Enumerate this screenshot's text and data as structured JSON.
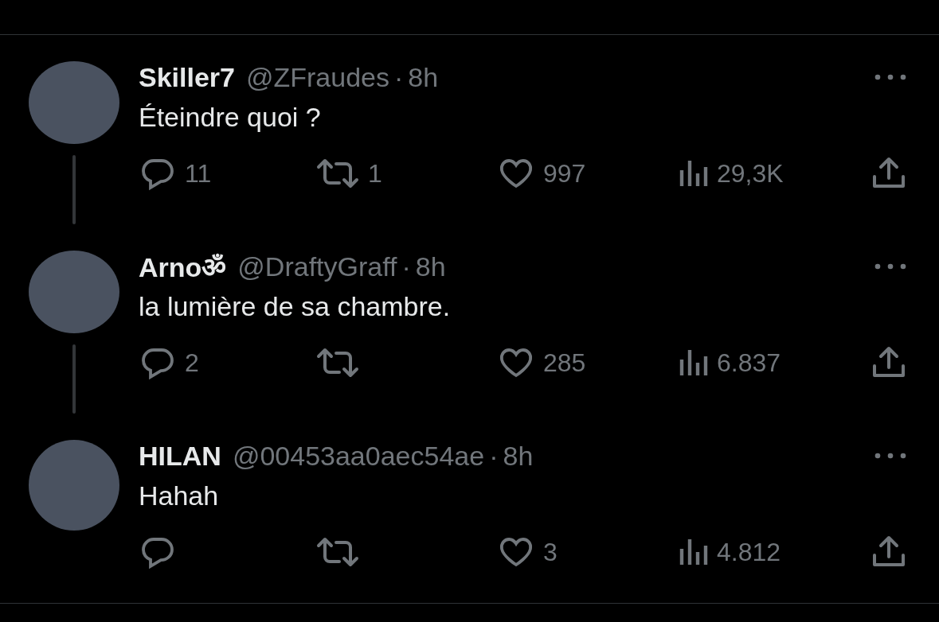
{
  "tweets": [
    {
      "name": "Skiller7",
      "handle": "@ZFraudes",
      "separator": "·",
      "time": "8h",
      "text": "Éteindre quoi ?",
      "thread_line": true,
      "replies": "11",
      "reposts": "1",
      "likes": "997",
      "views": "29,3K"
    },
    {
      "name": "Arnoॐ",
      "handle": "@DraftyGraff",
      "separator": "·",
      "time": "8h",
      "text": "la lumière de sa chambre.",
      "thread_line": true,
      "replies": "2",
      "likes": "285",
      "views": "6.837"
    },
    {
      "name": "HILAN",
      "handle": "@00453aa0aec54ae",
      "separator": "·",
      "time": "8h",
      "text": "Hahah",
      "thread_line": false,
      "likes": "3",
      "views": "4.812"
    }
  ]
}
